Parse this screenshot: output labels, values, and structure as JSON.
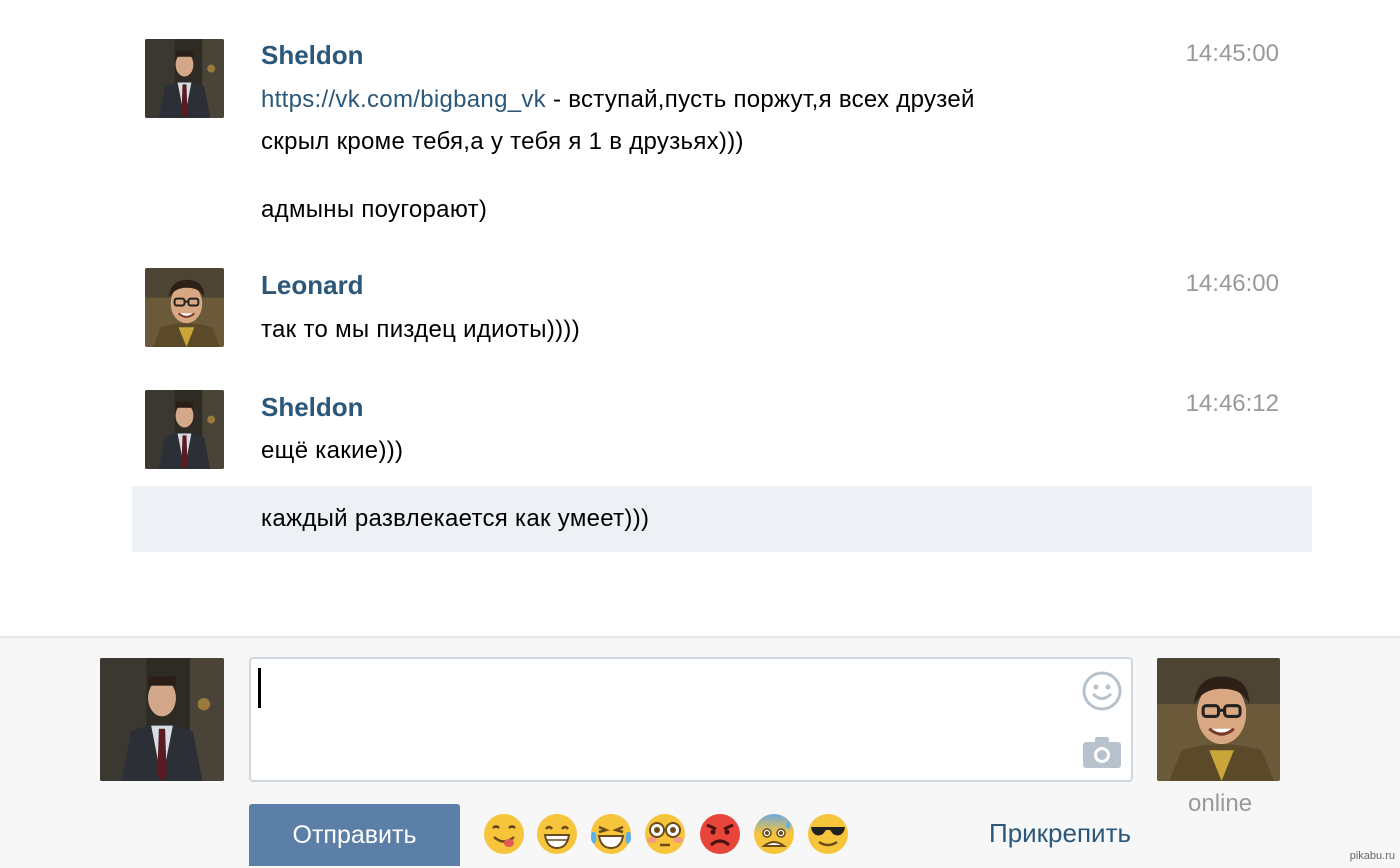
{
  "messages": [
    {
      "author": "Sheldon",
      "time": "14:45:00",
      "link": "https://vk.com/bigbang_vk",
      "line1_rest": " - вступай,пусть поржут,я всех друзей",
      "line2": "скрыл кроме тебя,а у тебя я 1 в друзьях)))",
      "line3": "адмыны поугорают)"
    },
    {
      "author": "Leonard",
      "time": "14:46:00",
      "line1": "так то мы пиздец идиоты))))"
    },
    {
      "author": "Sheldon",
      "time": "14:46:12",
      "line1": "ещё какие)))",
      "line2": "каждый развлекается как умеет)))"
    }
  ],
  "composer": {
    "send_label": "Отправить",
    "attach_label": "Прикрепить",
    "status": "online",
    "input_value": "",
    "emojis": [
      "yum-emoji",
      "grin-emoji",
      "joy-emoji",
      "flushed-emoji",
      "angry-emoji",
      "cold-sweat-emoji",
      "sunglasses-emoji"
    ]
  },
  "watermark": "pikabu.ru",
  "colors": {
    "name": "#2b587a",
    "time": "#999999",
    "send_button": "#5b7fa6",
    "highlight_row": "#edf1f5"
  }
}
